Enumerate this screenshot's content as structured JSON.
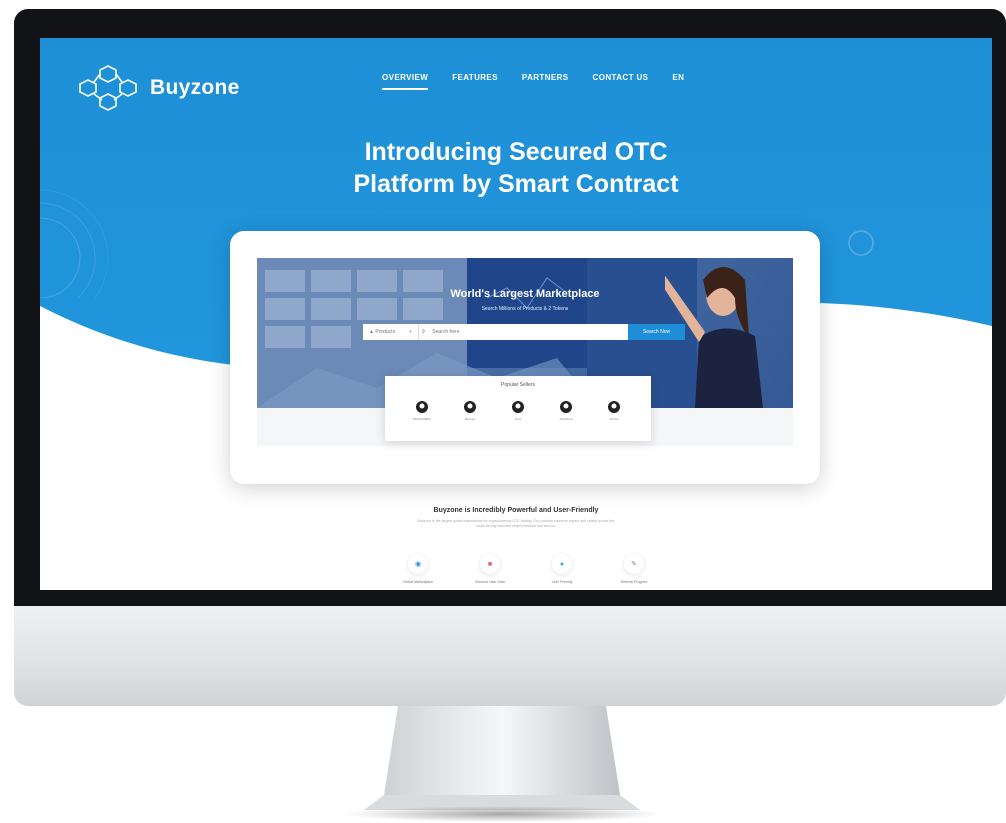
{
  "site": {
    "brand": "Buyzone",
    "nav": [
      "OVERVIEW",
      "FEATURES",
      "PARTNERS",
      "CONTACT US",
      "EN"
    ],
    "hero_title_line1": "Introducing Secured OTC",
    "hero_title_line2": "Platform by Smart Contract"
  },
  "banner": {
    "title": "World's Largest Marketplace",
    "subtitle": "Search Millions of Products & 2 Tokens",
    "search": {
      "category": "Products",
      "placeholder": "Search here",
      "button": "Search Now"
    }
  },
  "sellers": {
    "title": "Popular Sellers",
    "names": [
      "BRANDNEW",
      "Mkeygo",
      "Luxe",
      "ArtsWood",
      "Moche"
    ]
  },
  "section": {
    "title": "Buyzone is Incredibly Powerful and User-Friendly",
    "text": "Buyzone is the largest global marketplace for cryptocurrency OTC trading. Our platform connects buyers and sellers across the world through secured smart contracts and escrow.",
    "features": [
      {
        "label": "Global Marketplace",
        "icon": "globe-icon",
        "color": "#2a8fd8"
      },
      {
        "label": "Secured User Data",
        "icon": "lock-icon",
        "color": "#e45b5b"
      },
      {
        "label": "User Friendly",
        "icon": "hand-icon",
        "color": "#3aa8d8"
      },
      {
        "label": "Referral Program",
        "icon": "edit-icon",
        "color": "#888888"
      }
    ]
  },
  "colors": {
    "brand_blue": "#1e8fd6",
    "monitor_bezel": "#121316",
    "monitor_chin": "#e2e5e8"
  }
}
